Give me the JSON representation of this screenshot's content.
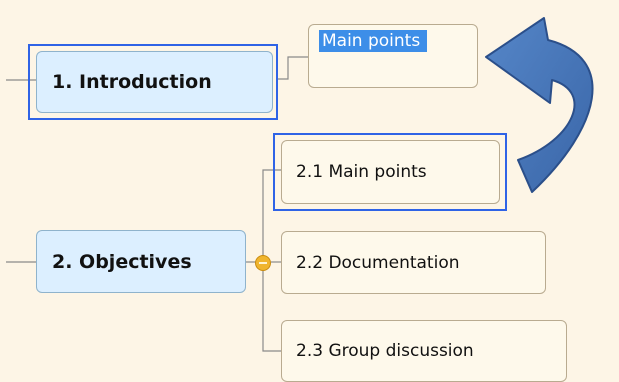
{
  "mindmap": {
    "intro": {
      "label": "1.  Introduction"
    },
    "intro_child": {
      "label": "Main points"
    },
    "objectives": {
      "label": "2.  Objectives"
    },
    "objectives_children": [
      {
        "label": "2.1  Main points"
      },
      {
        "label": "2.2  Documentation"
      },
      {
        "label": "2.3  Group discussion"
      }
    ]
  },
  "colors": {
    "background": "#fdf5e6",
    "main_topic_fill": "#dcefff",
    "subtopic_fill": "#fef9eb",
    "selection": "#2f63e6",
    "arrow": "#3f6fb6",
    "collapse_handle": "#f0b52e"
  },
  "icons": {
    "collapse_handle": "minus-circle-icon",
    "move_arrow": "curved-arrow-icon"
  }
}
